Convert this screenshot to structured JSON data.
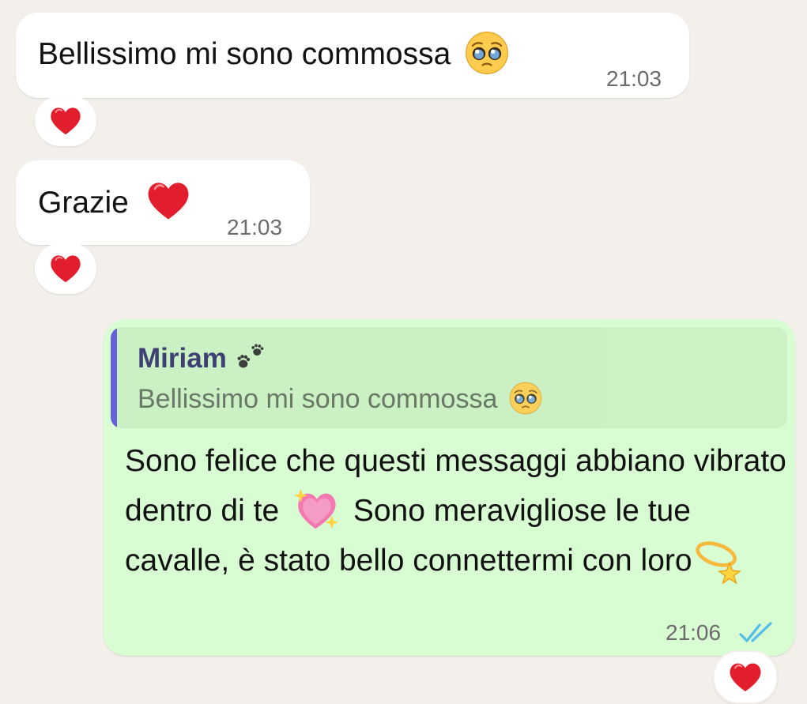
{
  "messages": [
    {
      "direction": "incoming",
      "text": "Bellissimo mi sono commossa",
      "emoji": "pleading-face",
      "time": "21:03",
      "reaction": "red-heart"
    },
    {
      "direction": "incoming",
      "text": "Grazie",
      "emoji": "red-heart",
      "time": "21:03",
      "reaction": "red-heart"
    },
    {
      "direction": "outgoing",
      "reply": {
        "author": "Miriam",
        "author_emoji": "paw-prints",
        "text": "Bellissimo mi sono commossa",
        "emoji": "pleading-face"
      },
      "segments": [
        "Sono felice che questi messaggi abbiano vibrato dentro di te",
        "Sono meravigliose le tue cavalle, è stato bello connettermi con loro"
      ],
      "emojis": [
        "sparkling-heart",
        "dizzy"
      ],
      "time": "21:06",
      "status": "read-double-check",
      "reaction": "red-heart"
    }
  ],
  "colors": {
    "background": "#f3f0eb",
    "incoming_bubble": "#ffffff",
    "outgoing_bubble": "#d9fdd3",
    "quote_bar": "#5b4ed6",
    "read_ticks": "#53bdeb"
  }
}
